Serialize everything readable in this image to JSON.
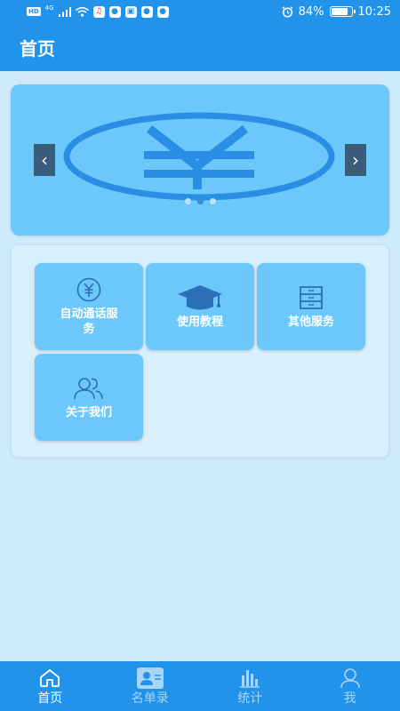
{
  "status_bar": {
    "hd_badge": "HD",
    "network": "4G",
    "battery": "84%",
    "battery_level": 0.84,
    "time": "10:25"
  },
  "header": {
    "title": "首页"
  },
  "banner": {
    "logo": "yen-emblem",
    "prev_icon": "chevron-left-icon",
    "next_icon": "chevron-right-icon",
    "prev_glyph": "‹",
    "next_glyph": "›",
    "slide_count": 3,
    "active_slide": 2
  },
  "menu": {
    "items": [
      {
        "label": "自动通话服务",
        "icon": "yen-circle-icon"
      },
      {
        "label": "使用教程",
        "icon": "graduation-cap-icon"
      },
      {
        "label": "其他服务",
        "icon": "cabinet-icon"
      },
      {
        "label": "关于我们",
        "icon": "users-icon"
      }
    ]
  },
  "bottom_nav": {
    "items": [
      {
        "label": "首页",
        "icon": "home-icon",
        "active": true
      },
      {
        "label": "名单录",
        "icon": "contact-card-icon",
        "active": false
      },
      {
        "label": "统计",
        "icon": "bar-chart-icon",
        "active": false
      },
      {
        "label": "我",
        "icon": "person-icon",
        "active": false
      }
    ]
  },
  "colors": {
    "primary": "#2293ea",
    "tile": "#6cc8fb",
    "background": "#cfeafb",
    "arrow": "#3a5d7a"
  }
}
